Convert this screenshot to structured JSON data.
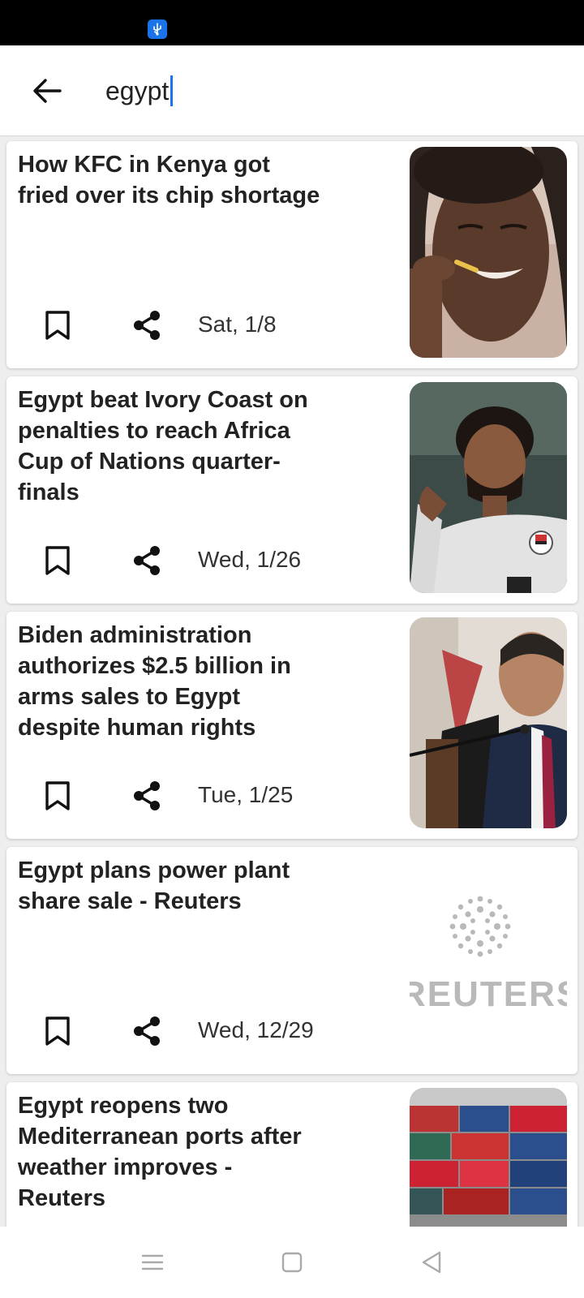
{
  "search": {
    "query": "egypt"
  },
  "articles": [
    {
      "title": "How KFC in Kenya got fried over its chip shortage",
      "date": "Sat, 1/8",
      "image_icon": "woman-eating-chip-photo"
    },
    {
      "title": "Egypt beat Ivory Coast on penalties to reach Africa Cup of Nations quarter-finals",
      "date": "Wed, 1/26",
      "image_icon": "footballer-pointing-photo"
    },
    {
      "title": "Biden administration authorizes $2.5 billion in arms sales to Egypt despite human rights",
      "date": "Tue, 1/25",
      "image_icon": "politician-at-microphone-photo"
    },
    {
      "title": "Egypt plans power plant share sale - Reuters",
      "date": "Wed, 12/29",
      "image_icon": "reuters-logo",
      "logo_text": "REUTERS"
    },
    {
      "title": "Egypt reopens two Mediterranean ports after weather improves - Reuters",
      "date": "",
      "image_icon": "shipping-containers-photo"
    }
  ],
  "colors": {
    "accent": "#1a73e8",
    "card_bg": "#ffffff",
    "list_bg": "#eeeeee",
    "text": "#222222"
  }
}
